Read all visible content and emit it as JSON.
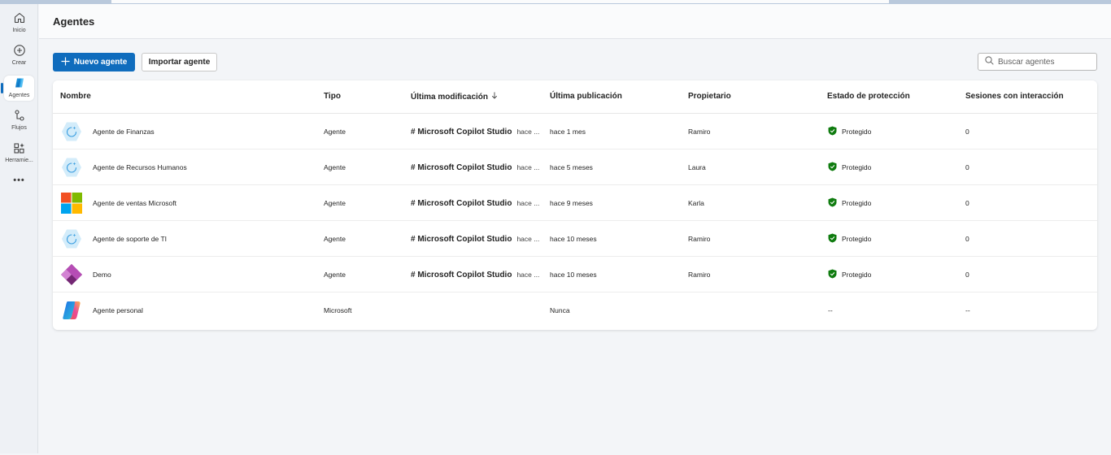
{
  "rail": {
    "items": [
      {
        "label": "Inicio",
        "icon": "home-icon"
      },
      {
        "label": "Crear",
        "icon": "add-circle-icon"
      },
      {
        "label": "Agentes",
        "icon": "agents-icon"
      },
      {
        "label": "Flujos",
        "icon": "flow-icon"
      },
      {
        "label": "Herramie...",
        "icon": "tools-icon"
      },
      {
        "label": "•••",
        "icon": "more-icon"
      }
    ]
  },
  "header": {
    "title": "Agentes"
  },
  "toolbar": {
    "new_agent_label": "Nuevo agente",
    "import_agent_label": "Importar agente",
    "search_placeholder": "Buscar agentes"
  },
  "table": {
    "columns": {
      "name": "Nombre",
      "type": "Tipo",
      "modified": "Última modificación",
      "published": "Última publicación",
      "owner": "Propietario",
      "protection": "Estado de protección",
      "sessions": "Sesiones con interacción"
    },
    "rows": [
      {
        "avatar": "copilot-studio-hex",
        "name": "Agente de Finanzas",
        "type": "Agente",
        "modified_by": "# Microsoft Copilot Studio",
        "modified_when": "hace ...",
        "published": "hace 1 mes",
        "owner": "Ramiro",
        "protection": "Protegido",
        "sessions": "0"
      },
      {
        "avatar": "copilot-studio-hex",
        "name": "Agente de Recursos Humanos",
        "type": "Agente",
        "modified_by": "# Microsoft Copilot Studio",
        "modified_when": "hace ...",
        "published": "hace 5 meses",
        "owner": "Laura",
        "protection": "Protegido",
        "sessions": "0"
      },
      {
        "avatar": "microsoft-logo",
        "name": "Agente de ventas Microsoft",
        "type": "Agente",
        "modified_by": "# Microsoft Copilot Studio",
        "modified_when": "hace ...",
        "published": "hace 9 meses",
        "owner": "Karla",
        "protection": "Protegido",
        "sessions": "0"
      },
      {
        "avatar": "copilot-studio-hex",
        "name": "Agente de soporte de TI",
        "type": "Agente",
        "modified_by": "# Microsoft Copilot Studio",
        "modified_when": "hace ...",
        "published": "hace 10 meses",
        "owner": "Ramiro",
        "protection": "Protegido",
        "sessions": "0"
      },
      {
        "avatar": "power-apps-diamond",
        "name": "Demo",
        "type": "Agente",
        "modified_by": "# Microsoft Copilot Studio",
        "modified_when": "hace ...",
        "published": "hace 10 meses",
        "owner": "Ramiro",
        "protection": "Protegido",
        "sessions": "0"
      },
      {
        "avatar": "copilot-logo",
        "name": "Agente personal",
        "type": "Microsoft",
        "modified_by": "",
        "modified_when": "",
        "published": "Nunca",
        "owner": "",
        "protection": "--",
        "sessions": "--"
      }
    ]
  },
  "colors": {
    "accent": "#0f6cbd",
    "protected_green": "#107c10"
  }
}
